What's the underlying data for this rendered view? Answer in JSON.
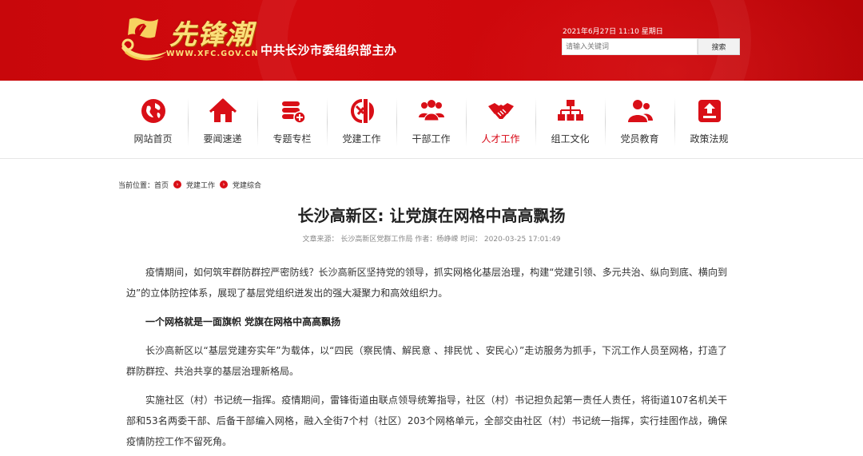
{
  "header": {
    "logo_brand": "先锋潮",
    "logo_url": "WWW.XFC.GOV.CN",
    "sponsor": "中共长沙市委组织部主办",
    "datetime": "2021年6月27日 11:10 星期日",
    "search": {
      "placeholder": "请输入关键词",
      "button_label": "搜索"
    },
    "colors": {
      "header_red": "#cc070b",
      "gold": "#fbe07a"
    }
  },
  "nav": {
    "items": [
      {
        "label": "网站首页",
        "icon": "globe-icon"
      },
      {
        "label": "要闻速递",
        "icon": "house-icon"
      },
      {
        "label": "专题专栏",
        "icon": "stack-plus-icon"
      },
      {
        "label": "党建工作",
        "icon": "party-emblem-icon"
      },
      {
        "label": "干部工作",
        "icon": "group-icon"
      },
      {
        "label": "人才工作",
        "icon": "handshake-icon",
        "active": true
      },
      {
        "label": "组工文化",
        "icon": "org-chart-icon"
      },
      {
        "label": "党员教育",
        "icon": "people-icon"
      },
      {
        "label": "政策法规",
        "icon": "upload-box-icon"
      }
    ],
    "icon_color": "#d90f17",
    "active_color": "#d7000f"
  },
  "breadcrumb": {
    "prefix": "当前位置：",
    "items": [
      "首页",
      "党建工作",
      "党建综合"
    ]
  },
  "article": {
    "title": "长沙高新区: 让党旗在网格中高高飘扬",
    "meta": "文章来源：  长沙高新区党群工作局  作者：杨峥嵘  时间：  2020-03-25 17:01:49",
    "paragraphs": [
      "疫情期间，如何筑牢群防群控严密防线？长沙高新区坚持党的领导，抓实网格化基层治理，构建“党建引领、多元共治、纵向到底、横向到边”的立体防控体系，展现了基层党组织迸发出的强大凝聚力和高效组织力。",
      "一个网格就是一面旗帜 党旗在网格中高高飘扬",
      "长沙高新区以“基层党建夯实年”为载体，以“四民（察民情、解民意 、排民忧 、安民心）”走访服务为抓手，下沉工作人员至网格，打造了群防群控、共治共享的基层治理新格局。",
      "实施社区（村）书记统一指挥。疫情期间，雷锋街道由联点领导统筹指导，社区（村）书记担负起第一责任人责任，将街道107名机关干部和53名两委干部、后备干部编入网格，融入全街7个村（社区）203个网格单元，全部交由社区（村）书记统一指挥，实行挂图作战，确保疫情防控工作不留死角。"
    ]
  }
}
